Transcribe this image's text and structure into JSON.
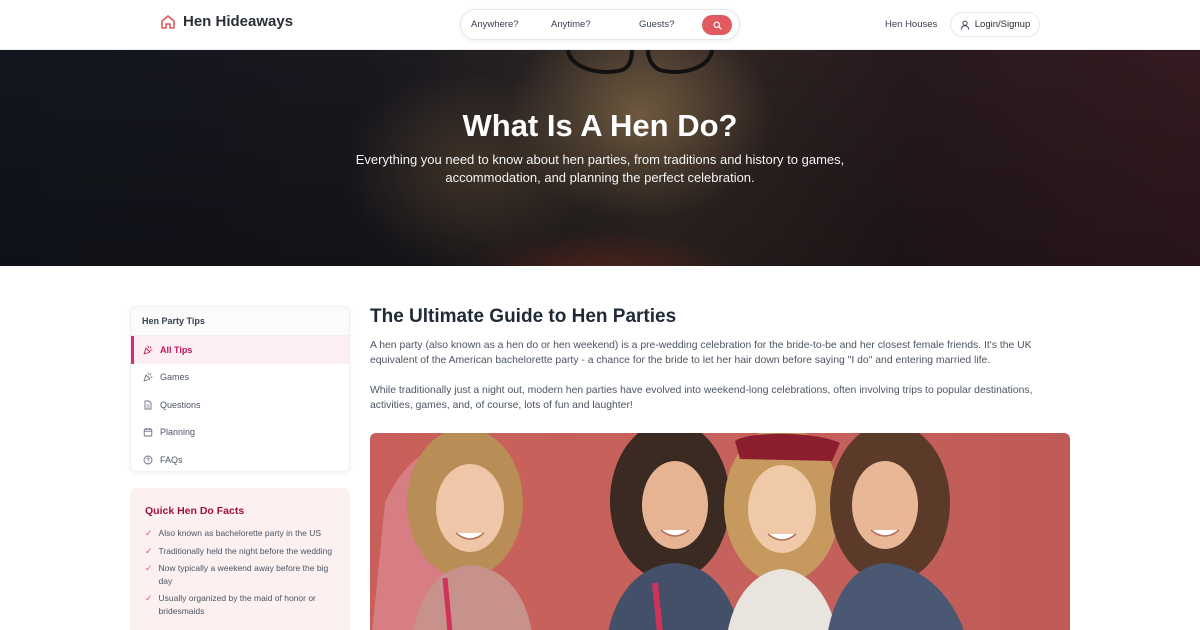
{
  "header": {
    "brand_name": "Hen Hideaways",
    "search": {
      "where": "Anywhere?",
      "when": "Anytime?",
      "guests": "Guests?"
    },
    "nav_link": "Hen Houses",
    "login_label": "Login/Signup"
  },
  "hero": {
    "title": "What Is A Hen Do?",
    "subtitle": "Everything you need to know about hen parties, from traditions and history to games, accommodation, and planning the perfect celebration."
  },
  "sidebar": {
    "heading": "Hen Party Tips",
    "items": [
      {
        "label": "All Tips",
        "icon": "party-popper-icon",
        "active": true
      },
      {
        "label": "Games",
        "icon": "party-popper-icon",
        "active": false
      },
      {
        "label": "Questions",
        "icon": "document-icon",
        "active": false
      },
      {
        "label": "Planning",
        "icon": "calendar-icon",
        "active": false
      },
      {
        "label": "FAQs",
        "icon": "help-circle-icon",
        "active": false
      }
    ],
    "facts": {
      "title": "Quick Hen Do Facts",
      "items": [
        "Also known as bachelorette party in the US",
        "Traditionally held the night before the wedding",
        "Now typically a weekend away before the big day",
        "Usually organized by the maid of honor or bridesmaids"
      ]
    }
  },
  "main": {
    "title": "The Ultimate Guide to Hen Parties",
    "paragraphs": [
      "A hen party (also known as a hen do or hen weekend) is a pre-wedding celebration for the bride-to-be and her closest female friends. It's the UK equivalent of the American bachelorette party - a chance for the bride to let her hair down before saying \"I do\" and entering married life.",
      "While traditionally just a night out, modern hen parties have evolved into weekend-long celebrations, often involving trips to popular destinations, activities, games, and, of course, lots of fun and laughter!"
    ]
  },
  "colors": {
    "accent": "#e05a5f",
    "active_pink": "#db2777",
    "facts_background": "#fdf0f1",
    "photo_backdrop": "#c6625d"
  }
}
